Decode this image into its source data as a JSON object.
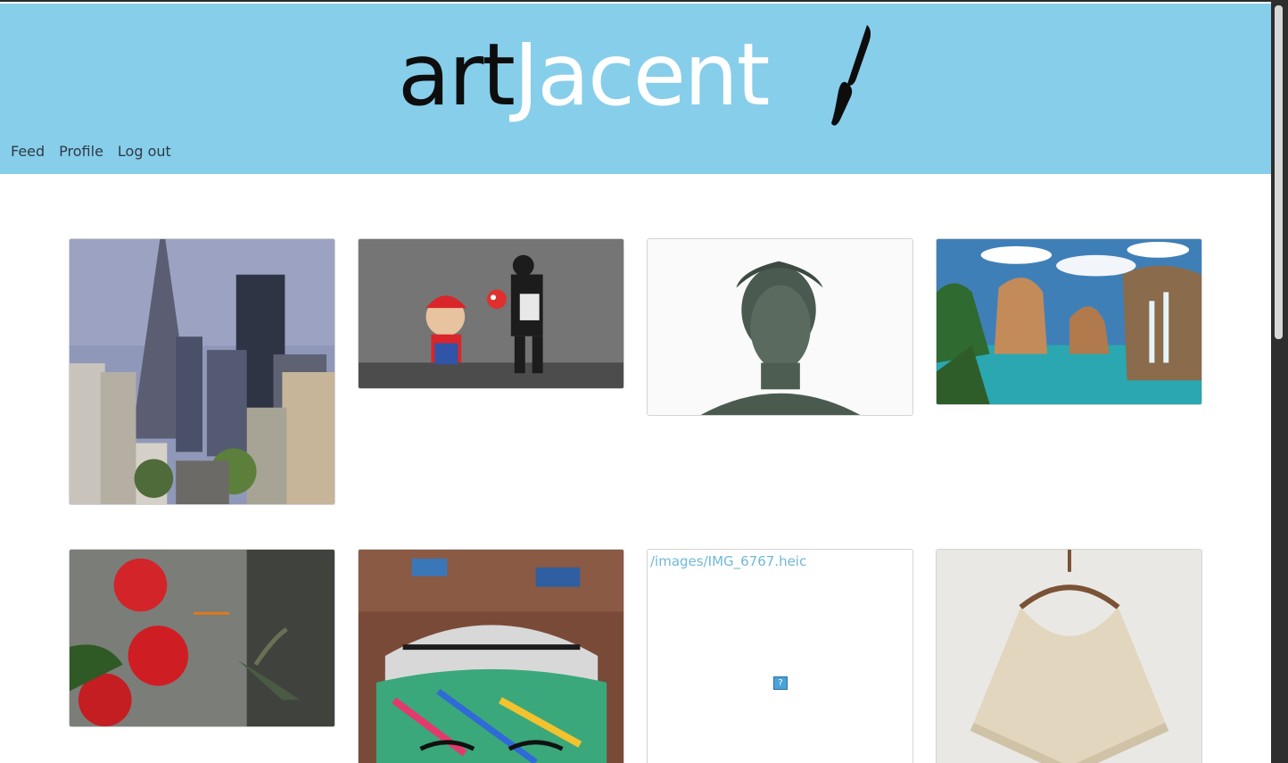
{
  "brand": {
    "part1": "art",
    "part2": "Jacent"
  },
  "nav": {
    "feed": "Feed",
    "profile": "Profile",
    "logout": "Log out"
  },
  "gallery": {
    "broken_image_src": "/images/IMG_6767.heic",
    "broken_icon": "?"
  },
  "colors": {
    "header": "#87ceeb",
    "link": "#6fb8d8"
  }
}
